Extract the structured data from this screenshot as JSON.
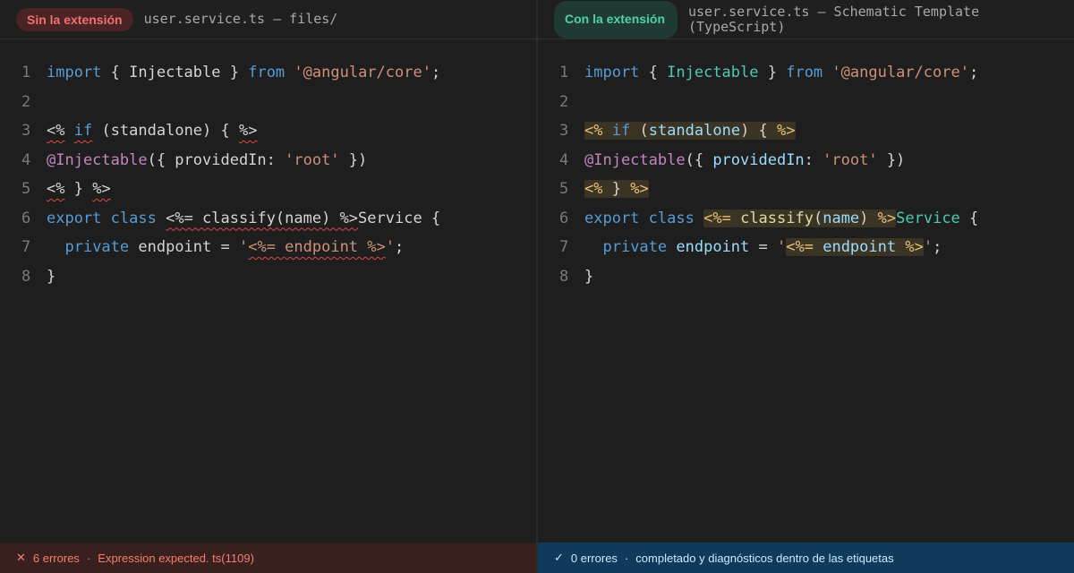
{
  "left": {
    "badge": "Sin la extensión",
    "title": "user.service.ts — files/",
    "status": {
      "icon": "✕",
      "count": "6 errores",
      "sep": "·",
      "message": "Expression expected. ts(1109)"
    },
    "lines": [
      [
        {
          "t": "import",
          "c": "kw"
        },
        {
          "t": " { "
        },
        {
          "t": "Injectable"
        },
        {
          "t": " } "
        },
        {
          "t": "from",
          "c": "kw"
        },
        {
          "t": " "
        },
        {
          "t": "'@angular/core'",
          "c": "str"
        },
        {
          "t": ";"
        }
      ],
      [],
      [
        {
          "t": "<%",
          "e": 1
        },
        {
          "t": " "
        },
        {
          "t": "if",
          "c": "kw",
          "e": 1
        },
        {
          "t": " (standalone) { "
        },
        {
          "t": "%>",
          "e": 1
        }
      ],
      [
        {
          "t": "@Injectable",
          "c": "dec"
        },
        {
          "t": "({ providedIn: "
        },
        {
          "t": "'root'",
          "c": "str"
        },
        {
          "t": " })"
        }
      ],
      [
        {
          "t": "<%",
          "e": 1
        },
        {
          "t": " } "
        },
        {
          "t": "%>",
          "e": 1
        }
      ],
      [
        {
          "t": "export",
          "c": "kw"
        },
        {
          "t": " "
        },
        {
          "t": "class",
          "c": "kw"
        },
        {
          "t": " "
        },
        {
          "t": "<%= classify(name) %>",
          "e": 1
        },
        {
          "t": "Service {"
        }
      ],
      [
        {
          "t": "  "
        },
        {
          "t": "private",
          "c": "kw"
        },
        {
          "t": " endpoint = "
        },
        {
          "t": "'",
          "c": "str"
        },
        {
          "t": "<%= endpoint %>",
          "c": "str",
          "e": 1
        },
        {
          "t": "'",
          "c": "str"
        },
        {
          "t": ";"
        }
      ],
      [
        {
          "t": "}"
        }
      ]
    ]
  },
  "right": {
    "badge": "Con la extensión",
    "title": "user.service.ts — Schematic Template (TypeScript)",
    "status": {
      "icon": "✓",
      "count": "0 errores",
      "sep": "·",
      "message": "completado y diagnósticos dentro de las etiquetas"
    },
    "lines": [
      [
        {
          "t": "import",
          "c": "kw"
        },
        {
          "t": " { "
        },
        {
          "t": "Injectable",
          "c": "cls"
        },
        {
          "t": " } "
        },
        {
          "t": "from",
          "c": "kw"
        },
        {
          "t": " "
        },
        {
          "t": "'@angular/core'",
          "c": "str"
        },
        {
          "t": ";"
        }
      ],
      [],
      [
        {
          "t": "<%",
          "c": "tag"
        },
        {
          "t": " ",
          "c": "tagbg"
        },
        {
          "t": "if",
          "c": "kw tagbg"
        },
        {
          "t": " (",
          "c": "tagbg"
        },
        {
          "t": "standalone",
          "c": "prop tagbg"
        },
        {
          "t": ") { ",
          "c": "tagbg"
        },
        {
          "t": "%>",
          "c": "tag"
        }
      ],
      [
        {
          "t": "@Injectable",
          "c": "dec"
        },
        {
          "t": "({ "
        },
        {
          "t": "providedIn",
          "c": "prop"
        },
        {
          "t": ": "
        },
        {
          "t": "'root'",
          "c": "str"
        },
        {
          "t": " })"
        }
      ],
      [
        {
          "t": "<%",
          "c": "tag"
        },
        {
          "t": " } ",
          "c": "tagbg"
        },
        {
          "t": "%>",
          "c": "tag"
        }
      ],
      [
        {
          "t": "export",
          "c": "kw"
        },
        {
          "t": " "
        },
        {
          "t": "class",
          "c": "kw"
        },
        {
          "t": " "
        },
        {
          "t": "<%=",
          "c": "tag"
        },
        {
          "t": " ",
          "c": "tagbg"
        },
        {
          "t": "classify",
          "c": "fn tagbg"
        },
        {
          "t": "(",
          "c": "tagbg"
        },
        {
          "t": "name",
          "c": "prop tagbg"
        },
        {
          "t": ") ",
          "c": "tagbg"
        },
        {
          "t": "%>",
          "c": "tag"
        },
        {
          "t": "Service",
          "c": "cls"
        },
        {
          "t": " {"
        }
      ],
      [
        {
          "t": "  "
        },
        {
          "t": "private",
          "c": "kw"
        },
        {
          "t": " "
        },
        {
          "t": "endpoint",
          "c": "prop"
        },
        {
          "t": " = "
        },
        {
          "t": "'",
          "c": "str"
        },
        {
          "t": "<%=",
          "c": "tag"
        },
        {
          "t": " ",
          "c": "tagbg"
        },
        {
          "t": "endpoint",
          "c": "prop tagbg"
        },
        {
          "t": " ",
          "c": "tagbg"
        },
        {
          "t": "%>",
          "c": "tag"
        },
        {
          "t": "'",
          "c": "str"
        },
        {
          "t": ";"
        }
      ],
      [
        {
          "t": "}"
        }
      ]
    ]
  }
}
